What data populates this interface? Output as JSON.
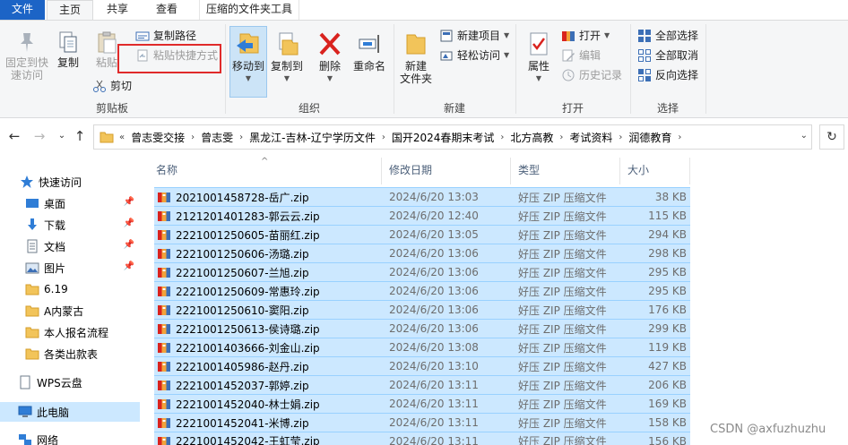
{
  "tabs": {
    "file": "文件",
    "home": "主页",
    "share": "共享",
    "view": "查看",
    "zip_tools": "压缩的文件夹工具"
  },
  "ribbon": {
    "clipboard": {
      "pin_quick_access": "固定到快\n速访问",
      "copy": "复制",
      "paste": "粘贴",
      "copy_path": "复制路径",
      "paste_shortcut": "粘贴快捷方式",
      "cut": "剪切",
      "group_label": "剪贴板"
    },
    "organize": {
      "move_to": "移动到",
      "copy_to": "复制到",
      "delete": "删除",
      "rename": "重命名",
      "group_label": "组织"
    },
    "new": {
      "new_folder": "新建\n文件夹",
      "new_item": "新建项目",
      "easy_access": "轻松访问",
      "group_label": "新建"
    },
    "open": {
      "properties": "属性",
      "open": "打开",
      "edit": "编辑",
      "history": "历史记录",
      "group_label": "打开"
    },
    "select": {
      "select_all": "全部选择",
      "select_none": "全部取消",
      "invert": "反向选择",
      "group_label": "选择"
    }
  },
  "address": {
    "crumbs": [
      "曾志雯交接",
      "曾志雯",
      "黑龙江-吉林-辽宁学历文件",
      "国开2024春期末考试",
      "北方高教",
      "考试资料",
      "润德教育"
    ],
    "overflow": "«"
  },
  "nav_pane": {
    "quick_access": "快速访问",
    "items": [
      "桌面",
      "下载",
      "文档",
      "图片",
      "6.19",
      "A内蒙古",
      "本人报名流程",
      "各类出款表"
    ],
    "wps_cloud": "WPS云盘",
    "this_pc": "此电脑",
    "network": "网络"
  },
  "columns": {
    "name": "名称",
    "date": "修改日期",
    "type": "类型",
    "size": "大小"
  },
  "files": [
    {
      "name": "2021001458728-岳广.zip",
      "date": "2024/6/20 13:03",
      "type": "好压 ZIP 压缩文件",
      "size": "38 KB"
    },
    {
      "name": "2121201401283-郭云云.zip",
      "date": "2024/6/20 12:40",
      "type": "好压 ZIP 压缩文件",
      "size": "115 KB"
    },
    {
      "name": "2221001250605-苗丽红.zip",
      "date": "2024/6/20 13:05",
      "type": "好压 ZIP 压缩文件",
      "size": "294 KB"
    },
    {
      "name": "2221001250606-汤璐.zip",
      "date": "2024/6/20 13:06",
      "type": "好压 ZIP 压缩文件",
      "size": "298 KB"
    },
    {
      "name": "2221001250607-兰旭.zip",
      "date": "2024/6/20 13:06",
      "type": "好压 ZIP 压缩文件",
      "size": "295 KB"
    },
    {
      "name": "2221001250609-常惠玲.zip",
      "date": "2024/6/20 13:06",
      "type": "好压 ZIP 压缩文件",
      "size": "295 KB"
    },
    {
      "name": "2221001250610-窦阳.zip",
      "date": "2024/6/20 13:06",
      "type": "好压 ZIP 压缩文件",
      "size": "176 KB"
    },
    {
      "name": "2221001250613-侯诗璐.zip",
      "date": "2024/6/20 13:06",
      "type": "好压 ZIP 压缩文件",
      "size": "299 KB"
    },
    {
      "name": "2221001403666-刘金山.zip",
      "date": "2024/6/20 13:08",
      "type": "好压 ZIP 压缩文件",
      "size": "119 KB"
    },
    {
      "name": "2221001405986-赵丹.zip",
      "date": "2024/6/20 13:10",
      "type": "好压 ZIP 压缩文件",
      "size": "427 KB"
    },
    {
      "name": "2221001452037-郭婷.zip",
      "date": "2024/6/20 13:11",
      "type": "好压 ZIP 压缩文件",
      "size": "206 KB"
    },
    {
      "name": "2221001452040-林士娟.zip",
      "date": "2024/6/20 13:11",
      "type": "好压 ZIP 压缩文件",
      "size": "169 KB"
    },
    {
      "name": "2221001452041-米博.zip",
      "date": "2024/6/20 13:11",
      "type": "好压 ZIP 压缩文件",
      "size": "158 KB"
    },
    {
      "name": "2221001452042-王虹莹.zip",
      "date": "2024/6/20 13:11",
      "type": "好压 ZIP 压缩文件",
      "size": "156 KB"
    }
  ],
  "watermark": "CSDN @axfuzhuzhu",
  "colors": {
    "accent": "#1c64c6",
    "selection": "#cce8ff",
    "selection_border": "#99d1ff",
    "highlight_box": "#e02a2a"
  }
}
